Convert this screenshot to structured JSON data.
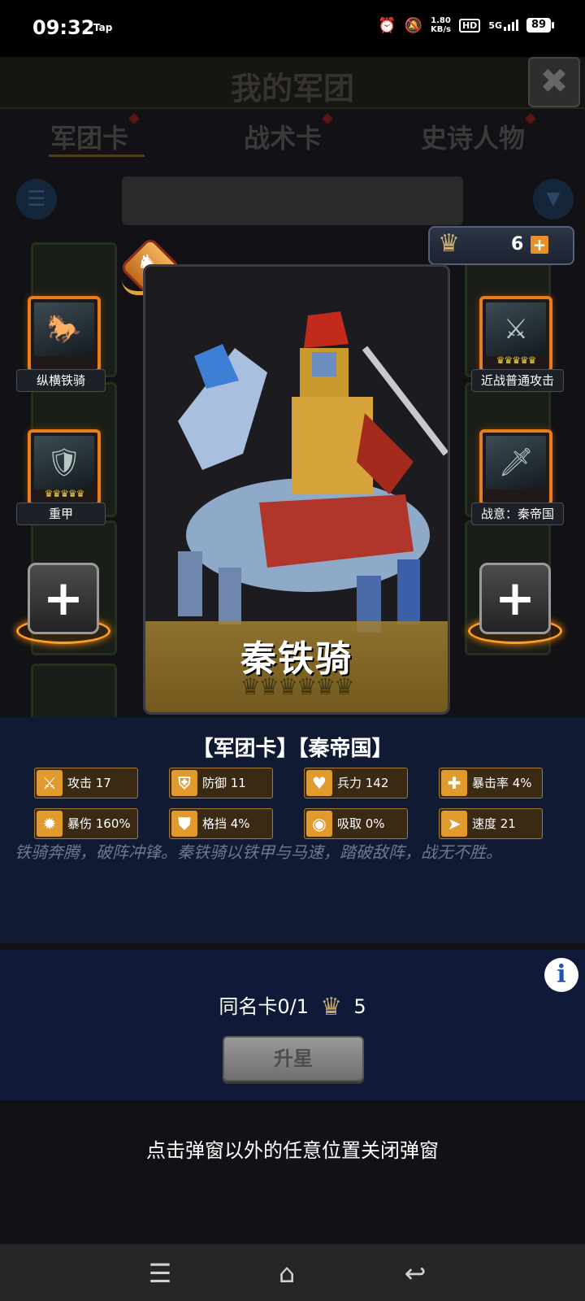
{
  "status_bar": {
    "time": "09:32",
    "tap": "Tap",
    "net_speed": "1.80",
    "net_unit": "KB/s",
    "hd": "HD",
    "network": "5G",
    "battery": "89"
  },
  "background": {
    "title": "我的军团",
    "tabs": [
      "军团卡",
      "战术卡",
      "史诗人物"
    ]
  },
  "resource": {
    "count": "6"
  },
  "skills_left": [
    {
      "label": "纵横铁骑"
    },
    {
      "label": "重甲"
    }
  ],
  "skills_right": [
    {
      "label": "近战普通攻击"
    },
    {
      "label": "战意：秦帝国"
    }
  ],
  "card": {
    "name": "秦铁骑",
    "tags": "【军团卡】【秦帝国】",
    "stars_shown": 6
  },
  "stats": [
    {
      "icon": "sword",
      "text": "攻击 17"
    },
    {
      "icon": "shield",
      "text": "防御 11"
    },
    {
      "icon": "heart",
      "text": "兵力 142"
    },
    {
      "icon": "crosshair",
      "text": "暴击率 4%"
    },
    {
      "icon": "burst",
      "text": "暴伤 160%"
    },
    {
      "icon": "block",
      "text": "格挡 4%"
    },
    {
      "icon": "absorb",
      "text": "吸取 0%"
    },
    {
      "icon": "boot",
      "text": "速度 21"
    }
  ],
  "description": "铁骑奔腾，破阵冲锋。秦铁骑以铁甲与马速，踏破敌阵，战无不胜。",
  "upgrade": {
    "dup_label": "同名卡0/1",
    "cost": "5",
    "button": "升星"
  },
  "close_hint": "点击弹窗以外的任意位置关闭弹窗",
  "colors": {
    "accent_orange": "#e87d19",
    "panel_blue": "#101a33",
    "stat_gold": "#e09a2e"
  }
}
